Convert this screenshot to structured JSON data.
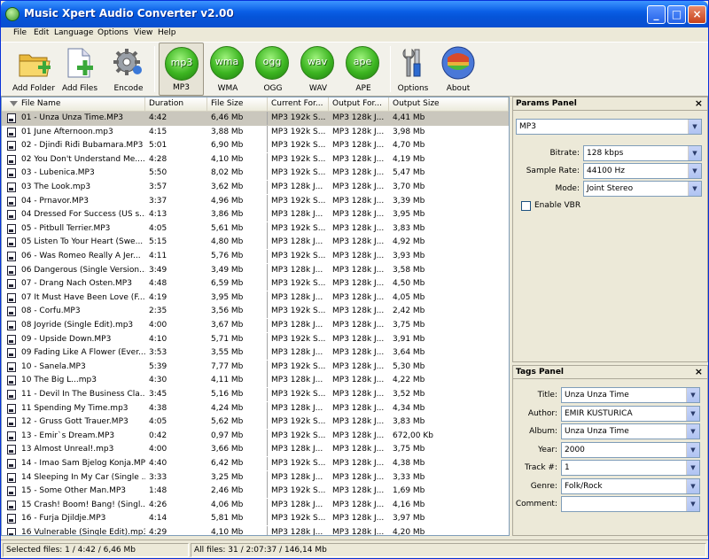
{
  "window": {
    "title": "Music Xpert Audio Converter v2.00"
  },
  "menu": [
    "File",
    "Edit",
    "Language",
    "Options",
    "View",
    "Help"
  ],
  "toolbar": {
    "add_folder": "Add Folder",
    "add_files": "Add Files",
    "encode": "Encode",
    "formats": [
      {
        "ball": "mp3",
        "label": "MP3",
        "selected": true
      },
      {
        "ball": "wma",
        "label": "WMA",
        "selected": false
      },
      {
        "ball": "ogg",
        "label": "OGG",
        "selected": false
      },
      {
        "ball": "wav",
        "label": "WAV",
        "selected": false
      },
      {
        "ball": "ape",
        "label": "APE",
        "selected": false
      }
    ],
    "options": "Options",
    "about": "About"
  },
  "list": {
    "columns": [
      "File Name",
      "Duration",
      "File Size",
      "Current For...",
      "Output For...",
      "Output Size"
    ],
    "rows": [
      [
        "01 - Unza Unza Time.MP3",
        "4:42",
        "6,46 Mb",
        "MP3 192k S...",
        "MP3 128k J...",
        "4,41 Mb"
      ],
      [
        "01 June Afternoon.mp3",
        "4:15",
        "3,88 Mb",
        "MP3 192k S...",
        "MP3 128k J...",
        "3,98 Mb"
      ],
      [
        "02 - Djinđi Riđi Bubamara.MP3",
        "5:01",
        "6,90 Mb",
        "MP3 192k S...",
        "MP3 128k J...",
        "4,70 Mb"
      ],
      [
        "02 You Don't Understand Me....",
        "4:28",
        "4,10 Mb",
        "MP3 192k S...",
        "MP3 128k J...",
        "4,19 Mb"
      ],
      [
        "03 - Lubenica.MP3",
        "5:50",
        "8,02 Mb",
        "MP3 192k S...",
        "MP3 128k J...",
        "5,47 Mb"
      ],
      [
        "03 The Look.mp3",
        "3:57",
        "3,62 Mb",
        "MP3 128k J...",
        "MP3 128k J...",
        "3,70 Mb"
      ],
      [
        "04 - Prnavor.MP3",
        "3:37",
        "4,96 Mb",
        "MP3 192k S...",
        "MP3 128k J...",
        "3,39 Mb"
      ],
      [
        "04 Dressed For Success (US s...",
        "4:13",
        "3,86 Mb",
        "MP3 128k J...",
        "MP3 128k J...",
        "3,95 Mb"
      ],
      [
        "05 - Pitbull Terrier.MP3",
        "4:05",
        "5,61 Mb",
        "MP3 192k S...",
        "MP3 128k J...",
        "3,83 Mb"
      ],
      [
        "05 Listen To Your Heart (Swe...",
        "5:15",
        "4,80 Mb",
        "MP3 128k J...",
        "MP3 128k J...",
        "4,92 Mb"
      ],
      [
        "06 - Was Romeo Really A Jer...",
        "4:11",
        "5,76 Mb",
        "MP3 192k S...",
        "MP3 128k J...",
        "3,93 Mb"
      ],
      [
        "06 Dangerous (Single Version...",
        "3:49",
        "3,49 Mb",
        "MP3 128k J...",
        "MP3 128k J...",
        "3,58 Mb"
      ],
      [
        "07 - Drang Nach Osten.MP3",
        "4:48",
        "6,59 Mb",
        "MP3 192k S...",
        "MP3 128k J...",
        "4,50 Mb"
      ],
      [
        "07 It Must Have Been Love (F...",
        "4:19",
        "3,95 Mb",
        "MP3 128k J...",
        "MP3 128k J...",
        "4,05 Mb"
      ],
      [
        "08 - Corfu.MP3",
        "2:35",
        "3,56 Mb",
        "MP3 192k S...",
        "MP3 128k J...",
        "2,42 Mb"
      ],
      [
        "08 Joyride (Single Edit).mp3",
        "4:00",
        "3,67 Mb",
        "MP3 128k J...",
        "MP3 128k J...",
        "3,75 Mb"
      ],
      [
        "09 - Upside Down.MP3",
        "4:10",
        "5,71 Mb",
        "MP3 192k S...",
        "MP3 128k J...",
        "3,91 Mb"
      ],
      [
        "09 Fading Like A Flower (Ever...",
        "3:53",
        "3,55 Mb",
        "MP3 128k J...",
        "MP3 128k J...",
        "3,64 Mb"
      ],
      [
        "10 - Sanela.MP3",
        "5:39",
        "7,77 Mb",
        "MP3 192k S...",
        "MP3 128k J...",
        "5,30 Mb"
      ],
      [
        "10 The Big L...mp3",
        "4:30",
        "4,11 Mb",
        "MP3 128k J...",
        "MP3 128k J...",
        "4,22 Mb"
      ],
      [
        "11 - Devil In The Business Cla...",
        "3:45",
        "5,16 Mb",
        "MP3 192k S...",
        "MP3 128k J...",
        "3,52 Mb"
      ],
      [
        "11 Spending My Time.mp3",
        "4:38",
        "4,24 Mb",
        "MP3 128k J...",
        "MP3 128k J...",
        "4,34 Mb"
      ],
      [
        "12 - Gruss Gott Trauer.MP3",
        "4:05",
        "5,62 Mb",
        "MP3 192k S...",
        "MP3 128k J...",
        "3,83 Mb"
      ],
      [
        "13 - Emir`s Dream.MP3",
        "0:42",
        "0,97 Mb",
        "MP3 192k S...",
        "MP3 128k J...",
        "672,00 Kb"
      ],
      [
        "13 Almost Unreal!.mp3",
        "4:00",
        "3,66 Mb",
        "MP3 128k J...",
        "MP3 128k J...",
        "3,75 Mb"
      ],
      [
        "14 - Imao Sam Bjelog Konja.MP3",
        "4:40",
        "6,42 Mb",
        "MP3 192k S...",
        "MP3 128k J...",
        "4,38 Mb"
      ],
      [
        "14 Sleeping In My Car (Single ...",
        "3:33",
        "3,25 Mb",
        "MP3 128k J...",
        "MP3 128k J...",
        "3,33 Mb"
      ],
      [
        "15 - Some Other Man.MP3",
        "1:48",
        "2,46 Mb",
        "MP3 192k S...",
        "MP3 128k J...",
        "1,69 Mb"
      ],
      [
        "15 Crash! Boom! Bang! (Singl...",
        "4:26",
        "4,06 Mb",
        "MP3 128k J...",
        "MP3 128k J...",
        "4,16 Mb"
      ],
      [
        "16 - Furja Djildje.MP3",
        "4:14",
        "5,81 Mb",
        "MP3 192k S...",
        "MP3 128k J...",
        "3,97 Mb"
      ],
      [
        "16 Vulnerable (Single Edit).mp3",
        "4:29",
        "4,10 Mb",
        "MP3 128k J...",
        "MP3 128k J...",
        "4,20 Mb"
      ]
    ]
  },
  "params": {
    "title": "Params Panel",
    "format": "MP3",
    "bitrate_label": "Bitrate:",
    "bitrate": "128 kbps",
    "samplerate_label": "Sample Rate:",
    "samplerate": "44100 Hz",
    "mode_label": "Mode:",
    "mode": "Joint Stereo",
    "vbr_label": "Enable VBR"
  },
  "tags": {
    "title": "Tags Panel",
    "fields": [
      {
        "label": "Title:",
        "value": "Unza Unza Time"
      },
      {
        "label": "Author:",
        "value": "EMIR KUSTURICA"
      },
      {
        "label": "Album:",
        "value": "Unza Unza Time"
      },
      {
        "label": "Year:",
        "value": "2000"
      },
      {
        "label": "Track #:",
        "value": "1"
      },
      {
        "label": "Genre:",
        "value": "Folk/Rock"
      },
      {
        "label": "Comment:",
        "value": ""
      }
    ]
  },
  "status": {
    "selected": "Selected files: 1 / 4:42 / 6,46 Mb",
    "all": "All files: 31 / 2:07:37 / 146,14 Mb"
  }
}
